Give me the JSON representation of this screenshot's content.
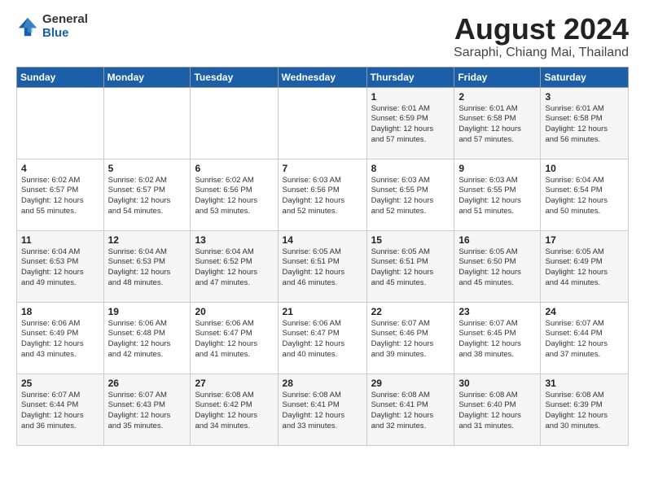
{
  "header": {
    "logo_general": "General",
    "logo_blue": "Blue",
    "title": "August 2024",
    "location": "Saraphi, Chiang Mai, Thailand"
  },
  "weekdays": [
    "Sunday",
    "Monday",
    "Tuesday",
    "Wednesday",
    "Thursday",
    "Friday",
    "Saturday"
  ],
  "weeks": [
    [
      {
        "day": "",
        "info": ""
      },
      {
        "day": "",
        "info": ""
      },
      {
        "day": "",
        "info": ""
      },
      {
        "day": "",
        "info": ""
      },
      {
        "day": "1",
        "info": "Sunrise: 6:01 AM\nSunset: 6:59 PM\nDaylight: 12 hours\nand 57 minutes."
      },
      {
        "day": "2",
        "info": "Sunrise: 6:01 AM\nSunset: 6:58 PM\nDaylight: 12 hours\nand 57 minutes."
      },
      {
        "day": "3",
        "info": "Sunrise: 6:01 AM\nSunset: 6:58 PM\nDaylight: 12 hours\nand 56 minutes."
      }
    ],
    [
      {
        "day": "4",
        "info": "Sunrise: 6:02 AM\nSunset: 6:57 PM\nDaylight: 12 hours\nand 55 minutes."
      },
      {
        "day": "5",
        "info": "Sunrise: 6:02 AM\nSunset: 6:57 PM\nDaylight: 12 hours\nand 54 minutes."
      },
      {
        "day": "6",
        "info": "Sunrise: 6:02 AM\nSunset: 6:56 PM\nDaylight: 12 hours\nand 53 minutes."
      },
      {
        "day": "7",
        "info": "Sunrise: 6:03 AM\nSunset: 6:56 PM\nDaylight: 12 hours\nand 52 minutes."
      },
      {
        "day": "8",
        "info": "Sunrise: 6:03 AM\nSunset: 6:55 PM\nDaylight: 12 hours\nand 52 minutes."
      },
      {
        "day": "9",
        "info": "Sunrise: 6:03 AM\nSunset: 6:55 PM\nDaylight: 12 hours\nand 51 minutes."
      },
      {
        "day": "10",
        "info": "Sunrise: 6:04 AM\nSunset: 6:54 PM\nDaylight: 12 hours\nand 50 minutes."
      }
    ],
    [
      {
        "day": "11",
        "info": "Sunrise: 6:04 AM\nSunset: 6:53 PM\nDaylight: 12 hours\nand 49 minutes."
      },
      {
        "day": "12",
        "info": "Sunrise: 6:04 AM\nSunset: 6:53 PM\nDaylight: 12 hours\nand 48 minutes."
      },
      {
        "day": "13",
        "info": "Sunrise: 6:04 AM\nSunset: 6:52 PM\nDaylight: 12 hours\nand 47 minutes."
      },
      {
        "day": "14",
        "info": "Sunrise: 6:05 AM\nSunset: 6:51 PM\nDaylight: 12 hours\nand 46 minutes."
      },
      {
        "day": "15",
        "info": "Sunrise: 6:05 AM\nSunset: 6:51 PM\nDaylight: 12 hours\nand 45 minutes."
      },
      {
        "day": "16",
        "info": "Sunrise: 6:05 AM\nSunset: 6:50 PM\nDaylight: 12 hours\nand 45 minutes."
      },
      {
        "day": "17",
        "info": "Sunrise: 6:05 AM\nSunset: 6:49 PM\nDaylight: 12 hours\nand 44 minutes."
      }
    ],
    [
      {
        "day": "18",
        "info": "Sunrise: 6:06 AM\nSunset: 6:49 PM\nDaylight: 12 hours\nand 43 minutes."
      },
      {
        "day": "19",
        "info": "Sunrise: 6:06 AM\nSunset: 6:48 PM\nDaylight: 12 hours\nand 42 minutes."
      },
      {
        "day": "20",
        "info": "Sunrise: 6:06 AM\nSunset: 6:47 PM\nDaylight: 12 hours\nand 41 minutes."
      },
      {
        "day": "21",
        "info": "Sunrise: 6:06 AM\nSunset: 6:47 PM\nDaylight: 12 hours\nand 40 minutes."
      },
      {
        "day": "22",
        "info": "Sunrise: 6:07 AM\nSunset: 6:46 PM\nDaylight: 12 hours\nand 39 minutes."
      },
      {
        "day": "23",
        "info": "Sunrise: 6:07 AM\nSunset: 6:45 PM\nDaylight: 12 hours\nand 38 minutes."
      },
      {
        "day": "24",
        "info": "Sunrise: 6:07 AM\nSunset: 6:44 PM\nDaylight: 12 hours\nand 37 minutes."
      }
    ],
    [
      {
        "day": "25",
        "info": "Sunrise: 6:07 AM\nSunset: 6:44 PM\nDaylight: 12 hours\nand 36 minutes."
      },
      {
        "day": "26",
        "info": "Sunrise: 6:07 AM\nSunset: 6:43 PM\nDaylight: 12 hours\nand 35 minutes."
      },
      {
        "day": "27",
        "info": "Sunrise: 6:08 AM\nSunset: 6:42 PM\nDaylight: 12 hours\nand 34 minutes."
      },
      {
        "day": "28",
        "info": "Sunrise: 6:08 AM\nSunset: 6:41 PM\nDaylight: 12 hours\nand 33 minutes."
      },
      {
        "day": "29",
        "info": "Sunrise: 6:08 AM\nSunset: 6:41 PM\nDaylight: 12 hours\nand 32 minutes."
      },
      {
        "day": "30",
        "info": "Sunrise: 6:08 AM\nSunset: 6:40 PM\nDaylight: 12 hours\nand 31 minutes."
      },
      {
        "day": "31",
        "info": "Sunrise: 6:08 AM\nSunset: 6:39 PM\nDaylight: 12 hours\nand 30 minutes."
      }
    ]
  ]
}
